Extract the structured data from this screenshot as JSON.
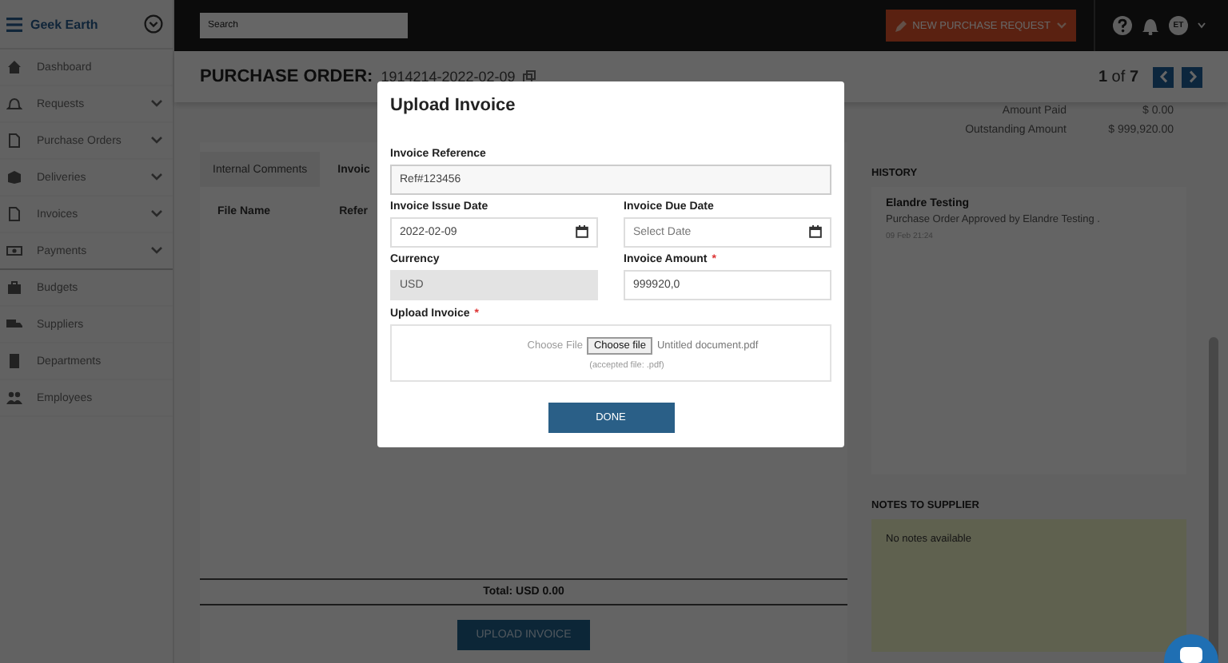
{
  "sidebar": {
    "brand": "Geek Earth",
    "items": [
      {
        "label": "Dashboard",
        "kind": "home",
        "expandable": false
      },
      {
        "label": "Requests",
        "kind": "bell",
        "expandable": true
      },
      {
        "label": "Purchase Orders",
        "kind": "doc",
        "expandable": true
      },
      {
        "label": "Deliveries",
        "kind": "box",
        "expandable": true
      },
      {
        "label": "Invoices",
        "kind": "doc",
        "expandable": true
      },
      {
        "label": "Payments",
        "kind": "cash",
        "expandable": true
      },
      {
        "label": "Budgets",
        "kind": "case",
        "expandable": false
      },
      {
        "label": "Suppliers",
        "kind": "truck",
        "expandable": false
      },
      {
        "label": "Departments",
        "kind": "building",
        "expandable": false
      },
      {
        "label": "Employees",
        "kind": "people",
        "expandable": false
      }
    ]
  },
  "topbar": {
    "search": {
      "placeholder": "Search"
    },
    "new_button": "NEW PURCHASE REQUEST",
    "avatar": "ET"
  },
  "header": {
    "label": "PURCHASE ORDER:",
    "number": "1914214-2022-02-09",
    "pager": "**1** of **7**"
  },
  "summary": [
    {
      "label": "Amount Paid",
      "value": "$ 0.00"
    },
    {
      "label": "Outstanding Amount",
      "value": "$ 999,920.00"
    }
  ],
  "tabs": [
    {
      "label": "Internal Comments",
      "selected": false
    },
    {
      "label": "Invoic",
      "selected": true
    }
  ],
  "table": {
    "columns": [
      "File Name",
      "Refer"
    ]
  },
  "total": "Total: USD 0.00",
  "upload_button": "UPLOAD INVOICE",
  "history": {
    "title": "HISTORY",
    "entries": [
      {
        "user": "Elandre Testing",
        "text": "Purchase Order Approved by Elandre Testing .",
        "time": "09 Feb 21:24"
      }
    ]
  },
  "notes": {
    "title": "NOTES TO SUPPLIER",
    "text": "No notes available"
  },
  "modal": {
    "title": "Upload Invoice",
    "required_mark": "*",
    "fields": [
      {
        "kind": "text",
        "label": "Invoice Reference",
        "value": "Ref#123456",
        "wide": true,
        "required": false,
        "disabled": false
      },
      {
        "kind": "date",
        "label": "Invoice Issue Date",
        "value": "2022-02-09",
        "wide": false,
        "required": false,
        "disabled": false
      },
      {
        "kind": "date",
        "label": "Invoice Due Date",
        "placeholder": "Select Date",
        "wide": false,
        "required": false,
        "disabled": false
      },
      {
        "kind": "text",
        "label": "Currency",
        "value": "USD",
        "wide": false,
        "required": false,
        "disabled": true
      },
      {
        "kind": "text",
        "label": "Invoice Amount",
        "value": "999920,0",
        "wide": false,
        "required": true,
        "disabled": false
      }
    ],
    "upload": {
      "label": "Upload Invoice",
      "required": true,
      "prompt": "Choose File",
      "button": "Choose file",
      "filename": "Untitled document.pdf",
      "hint": "(accepted file: .pdf)"
    },
    "done_button": "DONE"
  }
}
